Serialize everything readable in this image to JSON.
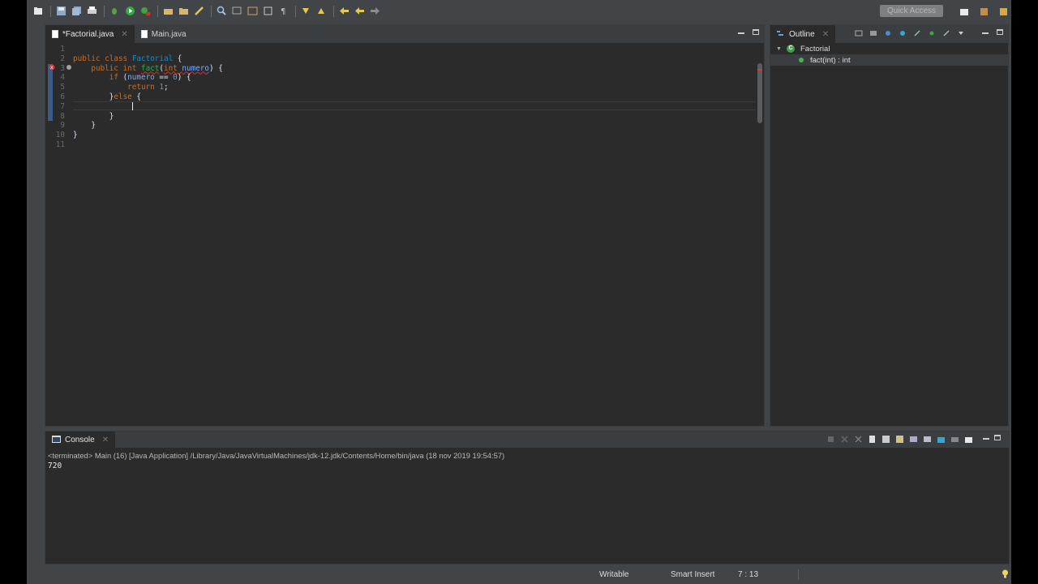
{
  "toolbar": {
    "quick_access_placeholder": "Quick Access",
    "icons": [
      "new-icon",
      "save-icon",
      "save-all-icon",
      "print-icon",
      "debug-icon",
      "run-icon",
      "run-config-icon",
      "open-type-icon",
      "open-folder-icon",
      "brush-icon",
      "search-icon",
      "tree-icon",
      "arrow-icon",
      "wrap-icon",
      "pilcrow-icon",
      "annotation-next-icon",
      "annotation-prev-icon",
      "back-icon",
      "forward-icon"
    ]
  },
  "editor": {
    "tabs": [
      {
        "label": "*Factorial.java",
        "active": true
      },
      {
        "label": "Main.java",
        "active": false
      }
    ],
    "line_numbers": [
      "1",
      "2",
      "3",
      "4",
      "5",
      "6",
      "7",
      "8",
      "9",
      "10",
      "11"
    ],
    "code_lines": [
      "",
      "public class Factorial {",
      "    public int fact(int numero) {",
      "        if (numero == 0) {",
      "            return 1;",
      "        }else {",
      "            ",
      "        }",
      "    }",
      "}",
      ""
    ],
    "cursor_position": "7 : 13"
  },
  "outline": {
    "title": "Outline",
    "class_name": "Factorial",
    "method": "fact(int) : int"
  },
  "console": {
    "title": "Console",
    "status": "<terminated> Main (16) [Java Application] /Library/Java/JavaVirtualMachines/jdk-12.jdk/Contents/Home/bin/java (18 nov 2019 19:54:57)",
    "output": "720"
  },
  "statusbar": {
    "writable": "Writable",
    "insert_mode": "Smart Insert",
    "position": "7 : 13"
  },
  "colors": {
    "background": "#424547",
    "editor_bg": "#2b2b2b",
    "keyword": "#cc6c1d",
    "type": "#1290c3",
    "method": "#1eb540",
    "error": "#e0302c"
  }
}
